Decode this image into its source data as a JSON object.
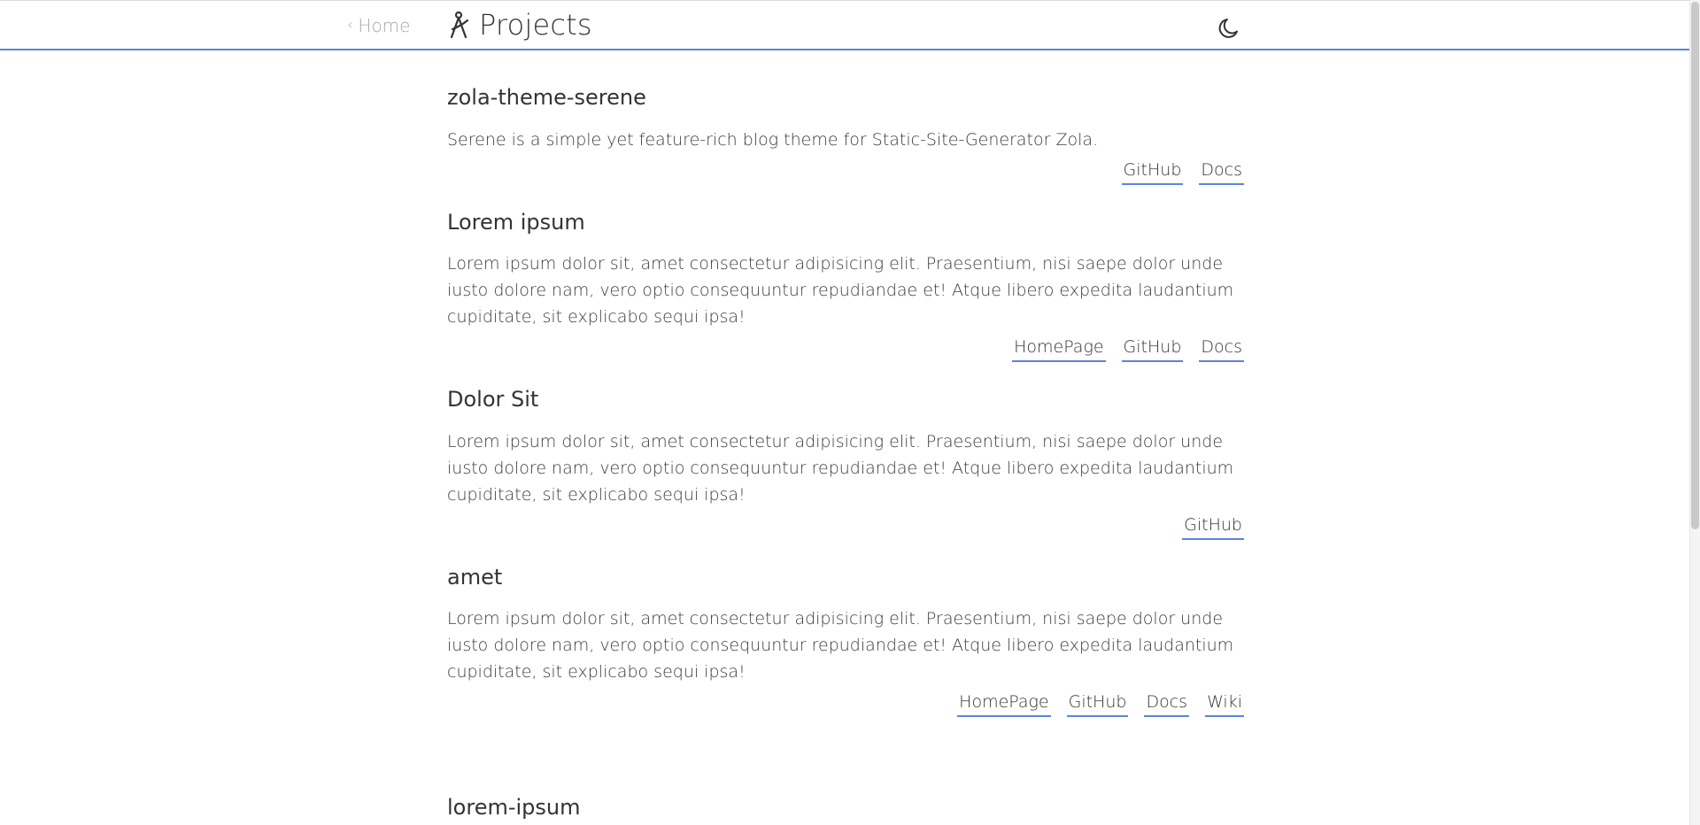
{
  "header": {
    "back_label": "Home",
    "title": "Projects"
  },
  "projects": [
    {
      "title": "zola-theme-serene",
      "description": "Serene is a simple yet feature-rich blog theme for Static-Site-Generator Zola.",
      "links": [
        "GitHub",
        "Docs"
      ]
    },
    {
      "title": "Lorem ipsum",
      "description": "Lorem ipsum dolor sit, amet consectetur adipisicing elit. Praesentium, nisi saepe dolor unde iusto dolore nam, vero optio consequuntur repudiandae et! Atque libero expedita laudantium cupiditate, sit explicabo sequi ipsa!",
      "links": [
        "HomePage",
        "GitHub",
        "Docs"
      ]
    },
    {
      "title": "Dolor Sit",
      "description": "Lorem ipsum dolor sit, amet consectetur adipisicing elit. Praesentium, nisi saepe dolor unde iusto dolore nam, vero optio consequuntur repudiandae et! Atque libero expedita laudantium cupiditate, sit explicabo sequi ipsa!",
      "links": [
        "GitHub"
      ]
    },
    {
      "title": "amet",
      "description": "Lorem ipsum dolor sit, amet consectetur adipisicing elit. Praesentium, nisi saepe dolor unde iusto dolore nam, vero optio consequuntur repudiandae et! Atque libero expedita laudantium cupiditate, sit explicabo sequi ipsa!",
      "links": [
        "HomePage",
        "GitHub",
        "Docs",
        "Wiki"
      ]
    }
  ],
  "partial_project": {
    "title": "lorem-ipsum"
  },
  "icons": {
    "back": "chevron-left-icon",
    "title": "compass-icon",
    "theme": "moon-icon"
  },
  "colors": {
    "accent": "#5b84e0",
    "text": "#333333",
    "muted": "#a8a8a8"
  }
}
